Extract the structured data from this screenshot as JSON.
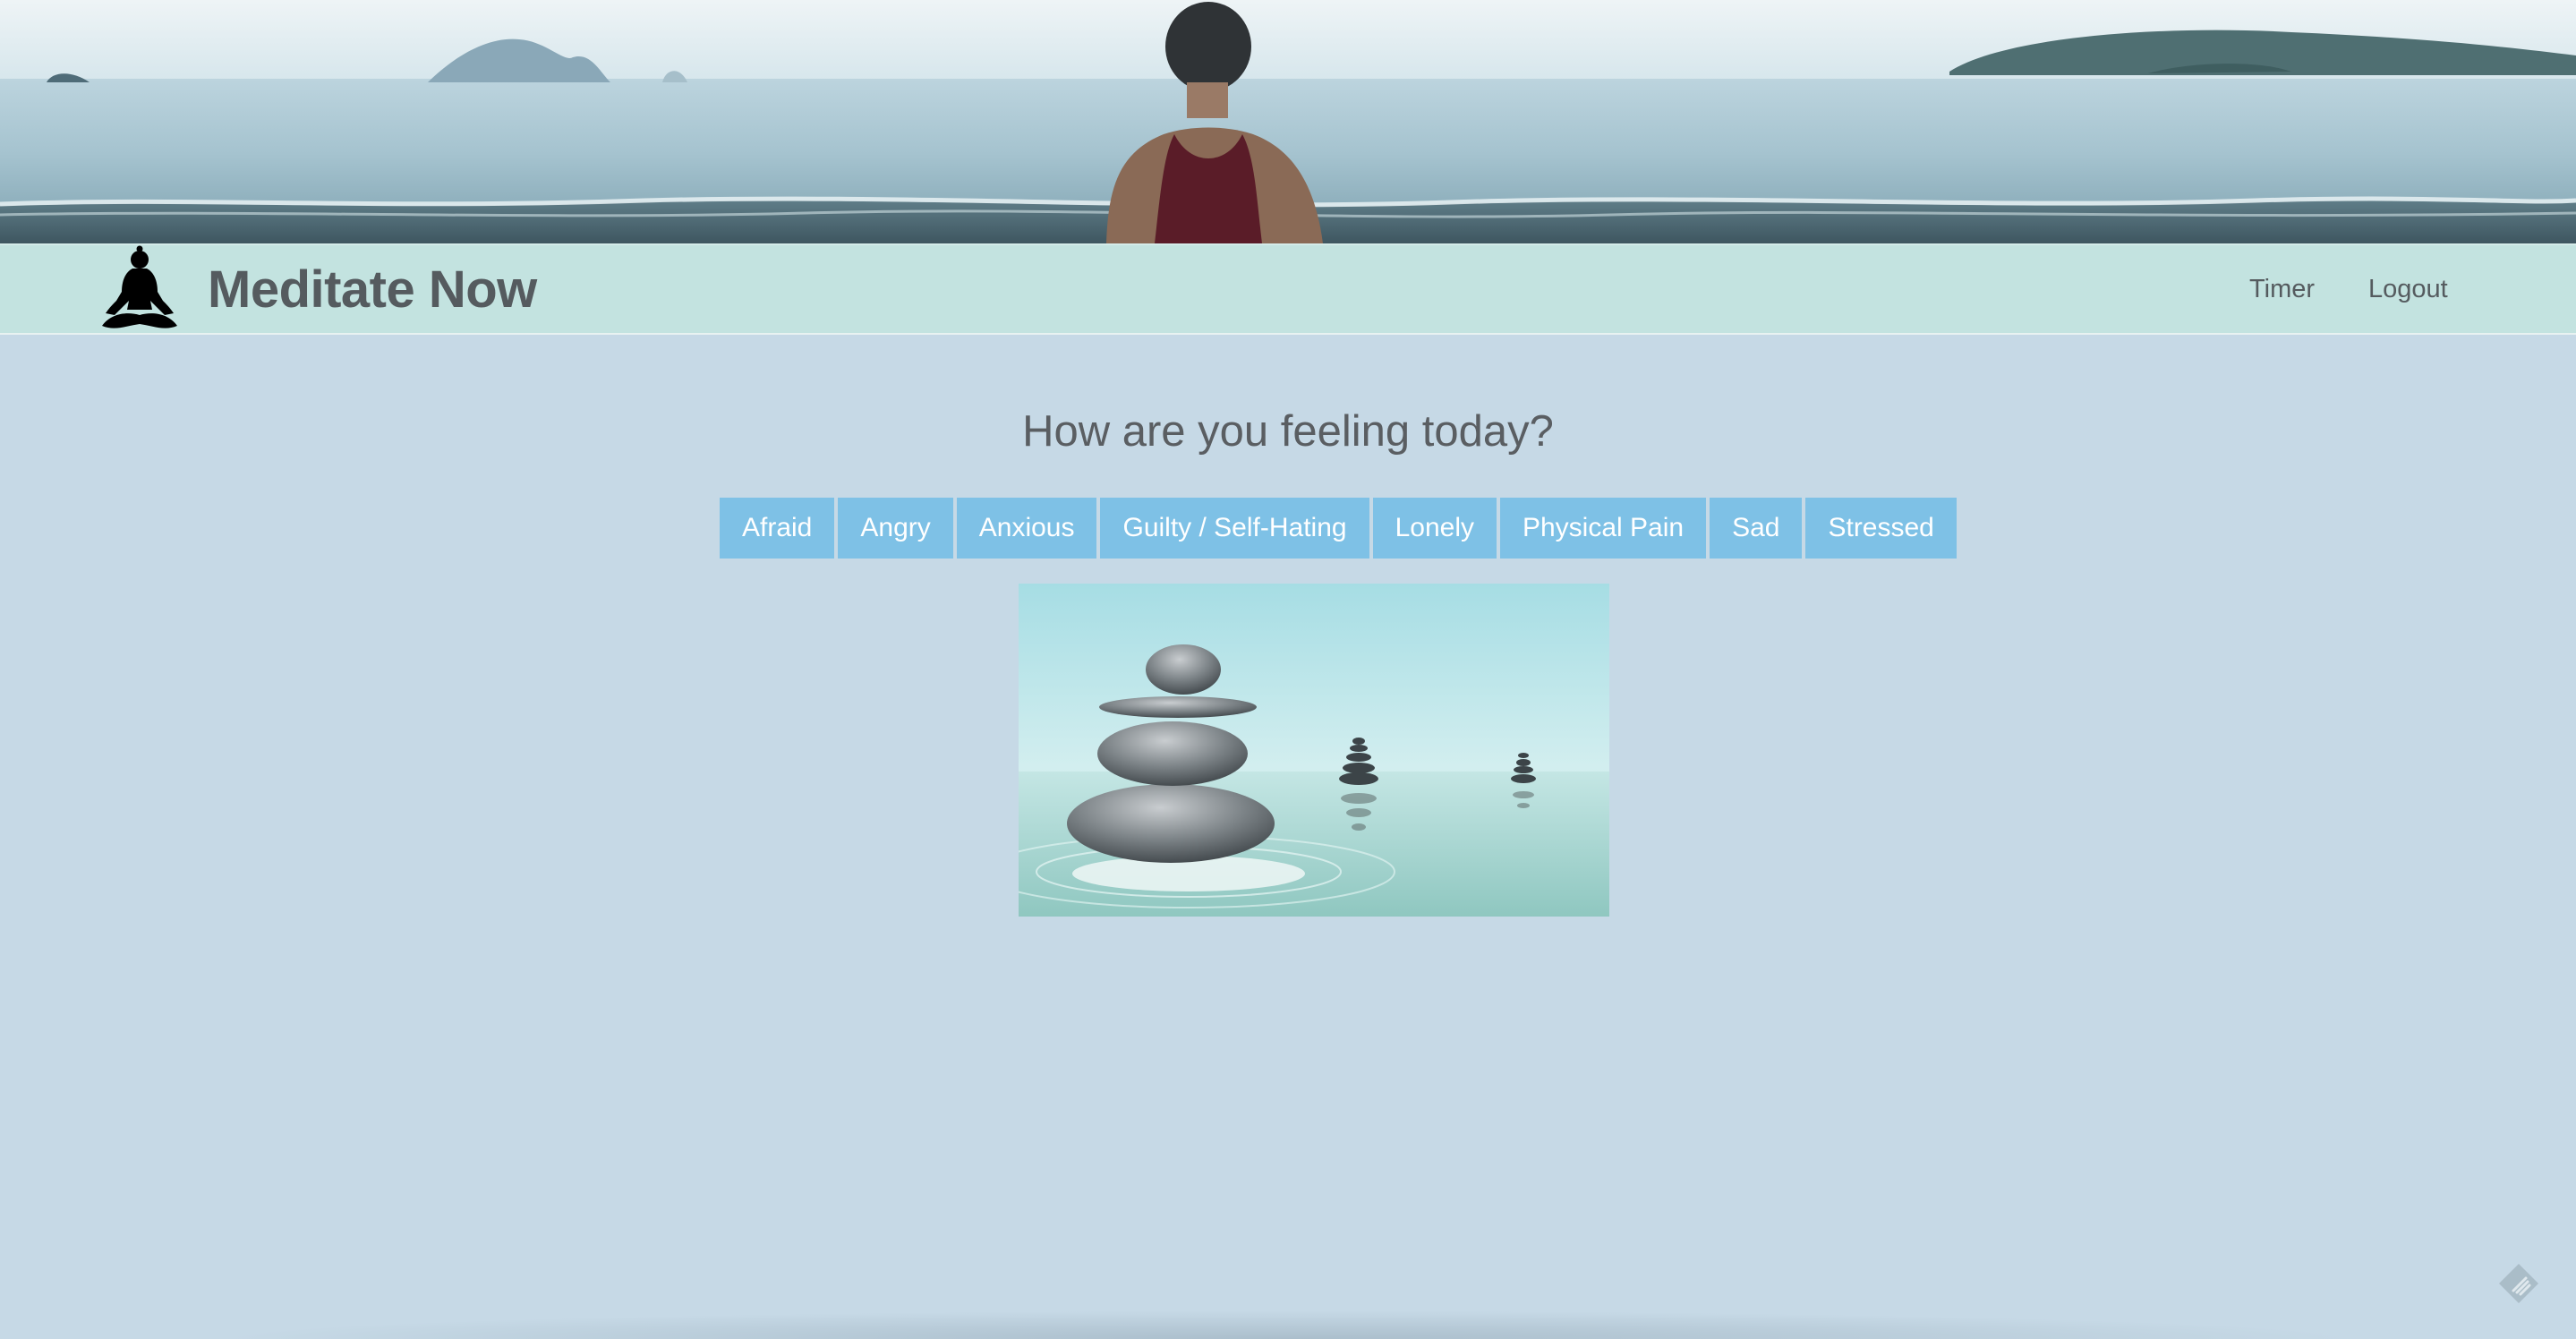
{
  "brand": {
    "title": "Meditate Now",
    "icon": "meditation-pose-icon"
  },
  "nav": {
    "timer_label": "Timer",
    "logout_label": "Logout"
  },
  "main": {
    "question": "How are you feeling today?",
    "moods": [
      {
        "label": "Afraid"
      },
      {
        "label": "Angry"
      },
      {
        "label": "Anxious"
      },
      {
        "label": "Guilty / Self-Hating"
      },
      {
        "label": "Lonely"
      },
      {
        "label": "Physical Pain"
      },
      {
        "label": "Sad"
      },
      {
        "label": "Stressed"
      }
    ]
  },
  "colors": {
    "page_background": "#c6d9e6",
    "navbar_background": "#c3e3e0",
    "button_background": "#7ec1e6",
    "button_text": "#ffffff",
    "text": "#555b5f"
  },
  "icons": {
    "hero": "beach-meditation-banner",
    "content_image": "stacked-zen-stones-image",
    "corner": "feedly-icon"
  }
}
